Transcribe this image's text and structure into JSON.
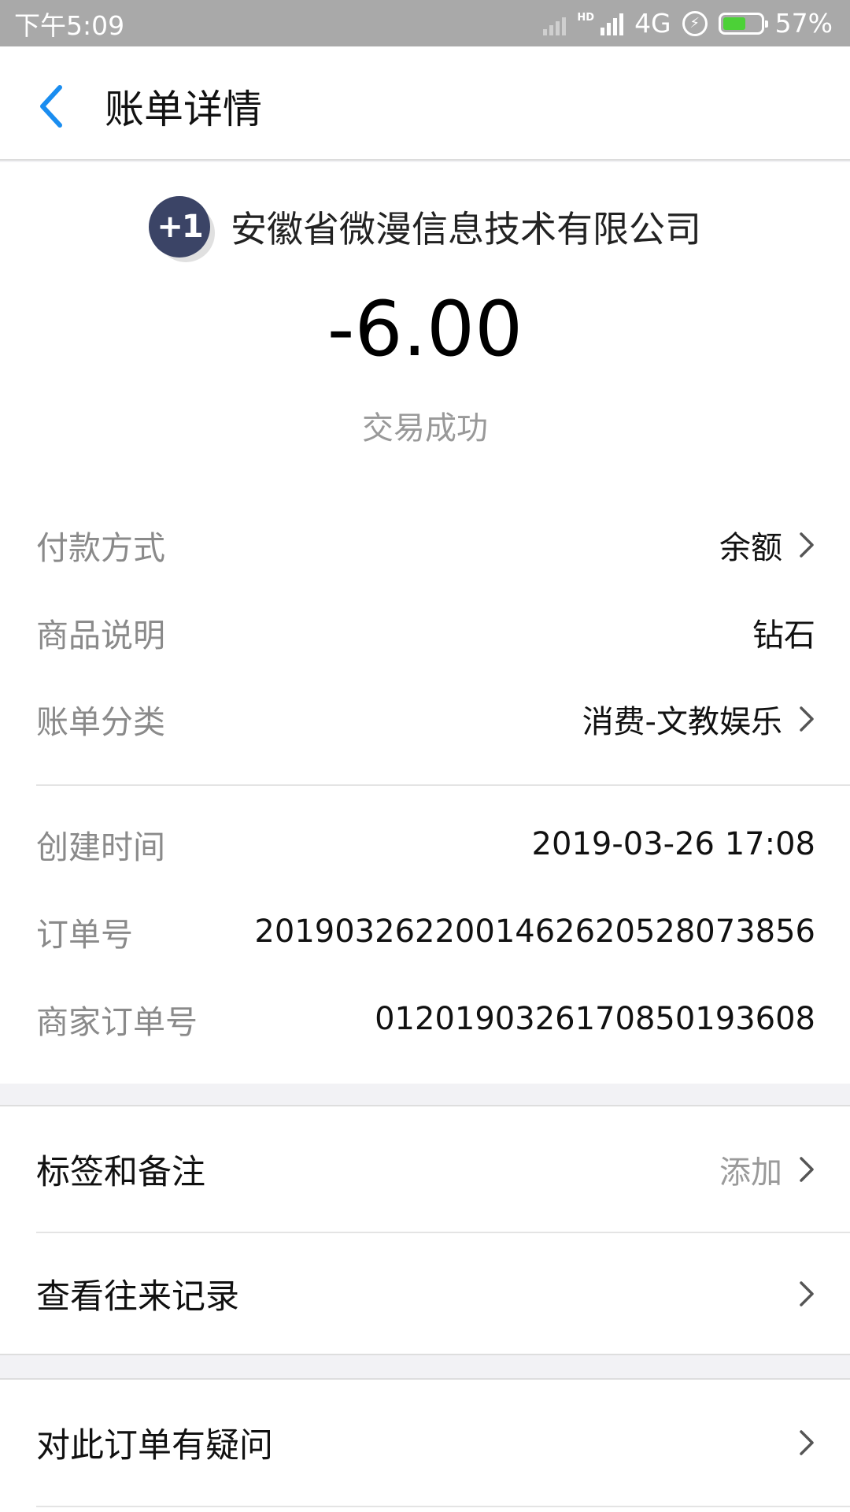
{
  "status_bar": {
    "time": "下午5:09",
    "network_hd": "HD",
    "network": "4G",
    "battery": "57%"
  },
  "header": {
    "title": "账单详情"
  },
  "merchant": {
    "logo_text": "+1",
    "name": "安徽省微漫信息技术有限公司"
  },
  "transaction": {
    "amount": "-6.00",
    "status": "交易成功"
  },
  "details": [
    {
      "label": "付款方式",
      "value": "余额"
    },
    {
      "label": "商品说明",
      "value": "钻石"
    },
    {
      "label": "账单分类",
      "value": "消费-文教娱乐"
    },
    {
      "label": "创建时间",
      "value": "2019-03-26 17:08"
    },
    {
      "label": "订单号",
      "value": "20190326220014626205280738​56"
    },
    {
      "label": "商家订单号",
      "value": "01201903261708501936​08"
    }
  ],
  "actions": {
    "tags": {
      "label": "标签和备注",
      "value": "添加"
    },
    "history": {
      "label": "查看往来记录"
    },
    "question": {
      "label": "对此订单有疑问"
    }
  },
  "colors": {
    "accent": "#1a8df0",
    "logo_bg": "#3b4466"
  }
}
